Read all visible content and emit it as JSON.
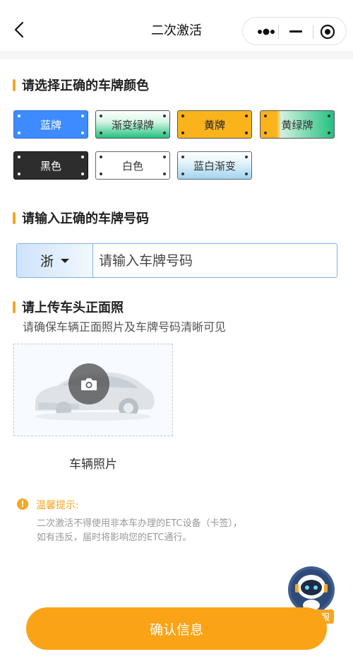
{
  "nav": {
    "title": "二次激活"
  },
  "section1": {
    "title": "请选择正确的车牌颜色",
    "plates": [
      {
        "label": "蓝牌"
      },
      {
        "label": "渐变绿牌"
      },
      {
        "label": "黄牌"
      },
      {
        "label": "黄绿牌"
      },
      {
        "label": "黑色"
      },
      {
        "label": "白色"
      },
      {
        "label": "蓝白渐变"
      }
    ]
  },
  "section2": {
    "title": "请输入正确的车牌号码",
    "province": "浙",
    "placeholder": "请输入车牌号码"
  },
  "section3": {
    "title": "请上传车头正面照",
    "subtitle": "请确保车辆正面照片及车牌号码清晰可见",
    "upload_label": "车辆照片"
  },
  "tips": {
    "icon_text": "!",
    "title": "温馨提示:",
    "line1": "二次激活不得使用非本车办理的ETC设备（卡签），",
    "line2": "如有违反，届时将影响您的ETC通行。"
  },
  "service": {
    "label": "在线客服"
  },
  "confirm_label": "确认信息",
  "colors": {
    "accent": "#f5a623",
    "button": "#fba316",
    "blue_plate": "#3d8bff",
    "yellow_plate": "#fbb31c",
    "green_plate": "#22c07f",
    "black_plate": "#2d2d2d"
  }
}
